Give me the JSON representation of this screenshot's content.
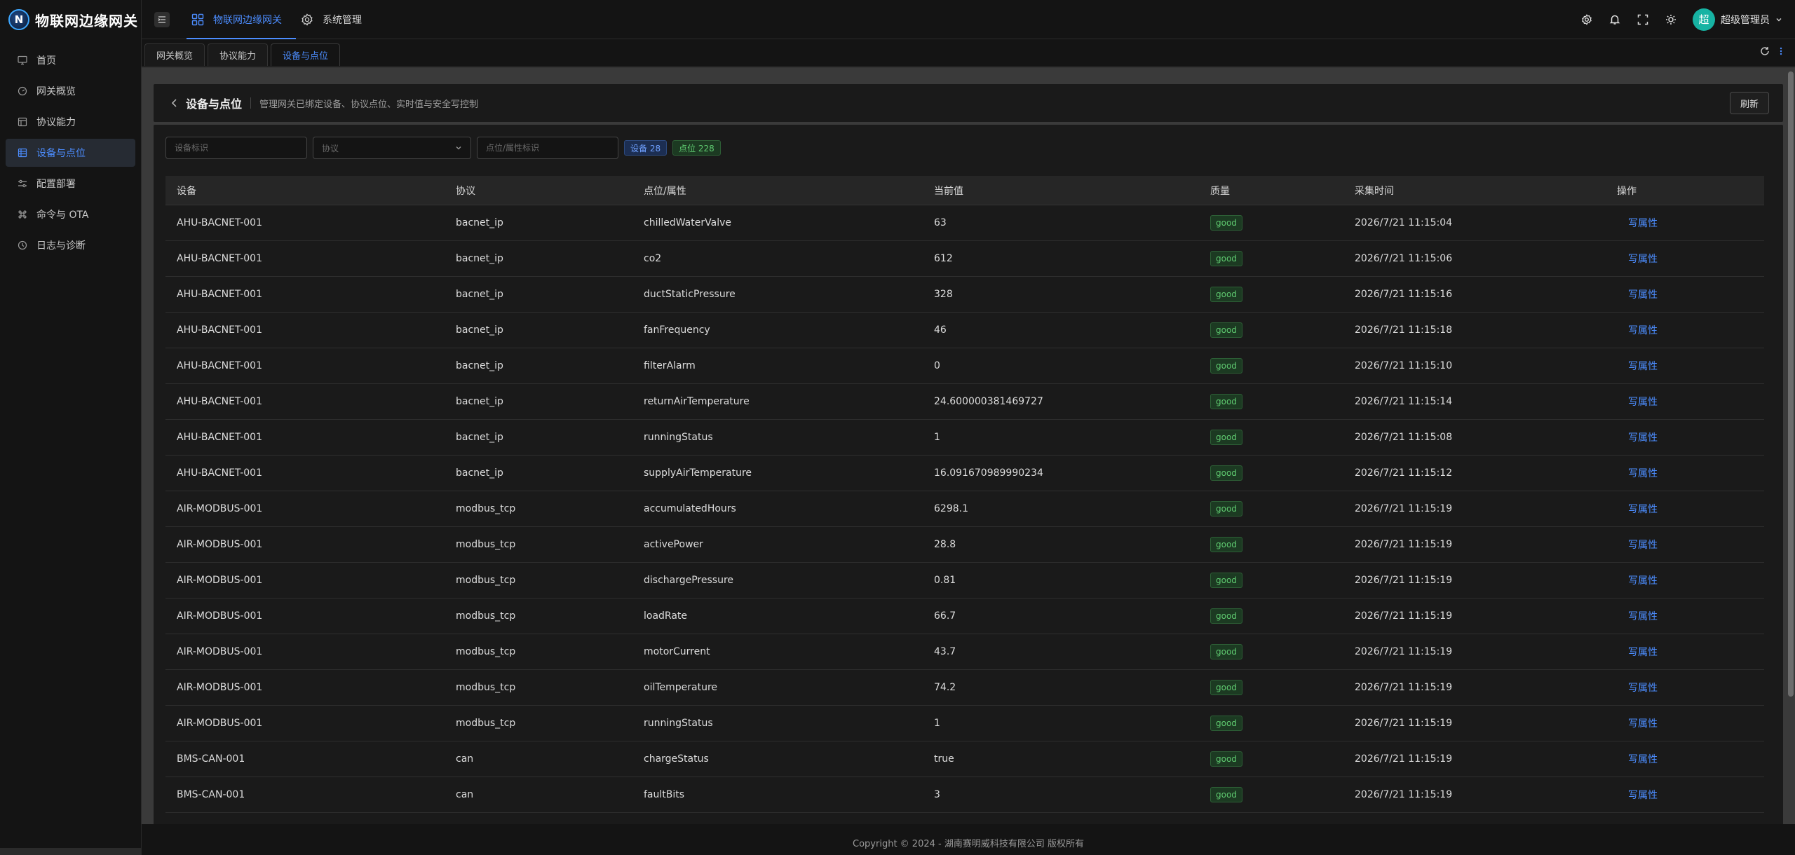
{
  "app": {
    "logo_letter": "N",
    "title": "物联网边缘网关"
  },
  "sidebar": {
    "items": [
      {
        "label": "首页",
        "icon": "monitor-icon"
      },
      {
        "label": "网关概览",
        "icon": "dashboard-icon"
      },
      {
        "label": "协议能力",
        "icon": "layout-icon"
      },
      {
        "label": "设备与点位",
        "icon": "list-icon",
        "active": true
      },
      {
        "label": "配置部署",
        "icon": "sliders-icon"
      },
      {
        "label": "命令与 OTA",
        "icon": "command-icon"
      },
      {
        "label": "日志与诊断",
        "icon": "clock-icon"
      }
    ]
  },
  "header": {
    "nav": [
      {
        "label": "物联网边缘网关",
        "icon": "grid-icon",
        "active": true
      },
      {
        "label": "系统管理",
        "icon": "gear-icon"
      }
    ],
    "user": {
      "avatar": "超",
      "name": "超级管理员"
    }
  },
  "tabs": [
    {
      "label": "网关概览"
    },
    {
      "label": "协议能力"
    },
    {
      "label": "设备与点位",
      "active": true
    }
  ],
  "page": {
    "title": "设备与点位",
    "description": "管理网关已绑定设备、协议点位、实时值与安全写控制",
    "refresh_label": "刷新"
  },
  "filters": {
    "device_placeholder": "设备标识",
    "protocol_placeholder": "协议",
    "point_placeholder": "点位/属性标识",
    "device_count": "设备 28",
    "point_count": "点位 228"
  },
  "table": {
    "headers": {
      "device": "设备",
      "protocol": "协议",
      "point": "点位/属性",
      "value": "当前值",
      "quality": "质量",
      "time": "采集时间",
      "action": "操作"
    },
    "rows": [
      {
        "device": "AHU-BACNET-001",
        "protocol": "bacnet_ip",
        "point": "chilledWaterValve",
        "value": "63",
        "quality": "good",
        "time": "2026/7/21 11:15:04",
        "action": "写属性"
      },
      {
        "device": "AHU-BACNET-001",
        "protocol": "bacnet_ip",
        "point": "co2",
        "value": "612",
        "quality": "good",
        "time": "2026/7/21 11:15:06",
        "action": "写属性"
      },
      {
        "device": "AHU-BACNET-001",
        "protocol": "bacnet_ip",
        "point": "ductStaticPressure",
        "value": "328",
        "quality": "good",
        "time": "2026/7/21 11:15:16",
        "action": "写属性"
      },
      {
        "device": "AHU-BACNET-001",
        "protocol": "bacnet_ip",
        "point": "fanFrequency",
        "value": "46",
        "quality": "good",
        "time": "2026/7/21 11:15:18",
        "action": "写属性"
      },
      {
        "device": "AHU-BACNET-001",
        "protocol": "bacnet_ip",
        "point": "filterAlarm",
        "value": "0",
        "quality": "good",
        "time": "2026/7/21 11:15:10",
        "action": "写属性"
      },
      {
        "device": "AHU-BACNET-001",
        "protocol": "bacnet_ip",
        "point": "returnAirTemperature",
        "value": "24.600000381469727",
        "quality": "good",
        "time": "2026/7/21 11:15:14",
        "action": "写属性"
      },
      {
        "device": "AHU-BACNET-001",
        "protocol": "bacnet_ip",
        "point": "runningStatus",
        "value": "1",
        "quality": "good",
        "time": "2026/7/21 11:15:08",
        "action": "写属性"
      },
      {
        "device": "AHU-BACNET-001",
        "protocol": "bacnet_ip",
        "point": "supplyAirTemperature",
        "value": "16.091670989990234",
        "quality": "good",
        "time": "2026/7/21 11:15:12",
        "action": "写属性"
      },
      {
        "device": "AIR-MODBUS-001",
        "protocol": "modbus_tcp",
        "point": "accumulatedHours",
        "value": "6298.1",
        "quality": "good",
        "time": "2026/7/21 11:15:19",
        "action": "写属性"
      },
      {
        "device": "AIR-MODBUS-001",
        "protocol": "modbus_tcp",
        "point": "activePower",
        "value": "28.8",
        "quality": "good",
        "time": "2026/7/21 11:15:19",
        "action": "写属性"
      },
      {
        "device": "AIR-MODBUS-001",
        "protocol": "modbus_tcp",
        "point": "dischargePressure",
        "value": "0.81",
        "quality": "good",
        "time": "2026/7/21 11:15:19",
        "action": "写属性"
      },
      {
        "device": "AIR-MODBUS-001",
        "protocol": "modbus_tcp",
        "point": "loadRate",
        "value": "66.7",
        "quality": "good",
        "time": "2026/7/21 11:15:19",
        "action": "写属性"
      },
      {
        "device": "AIR-MODBUS-001",
        "protocol": "modbus_tcp",
        "point": "motorCurrent",
        "value": "43.7",
        "quality": "good",
        "time": "2026/7/21 11:15:19",
        "action": "写属性"
      },
      {
        "device": "AIR-MODBUS-001",
        "protocol": "modbus_tcp",
        "point": "oilTemperature",
        "value": "74.2",
        "quality": "good",
        "time": "2026/7/21 11:15:19",
        "action": "写属性"
      },
      {
        "device": "AIR-MODBUS-001",
        "protocol": "modbus_tcp",
        "point": "runningStatus",
        "value": "1",
        "quality": "good",
        "time": "2026/7/21 11:15:19",
        "action": "写属性"
      },
      {
        "device": "BMS-CAN-001",
        "protocol": "can",
        "point": "chargeStatus",
        "value": "true",
        "quality": "good",
        "time": "2026/7/21 11:15:19",
        "action": "写属性"
      },
      {
        "device": "BMS-CAN-001",
        "protocol": "can",
        "point": "faultBits",
        "value": "3",
        "quality": "good",
        "time": "2026/7/21 11:15:19",
        "action": "写属性"
      }
    ]
  },
  "footer": {
    "text": "Copyright © 2024 - 湖南赛明威科技有限公司 版权所有"
  },
  "colors": {
    "accent": "#4c8dff",
    "good": "#5fca70",
    "avatar": "#17b3a3"
  }
}
